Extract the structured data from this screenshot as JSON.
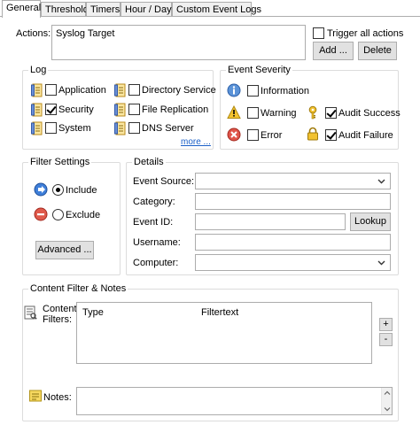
{
  "tabs": [
    {
      "label": "General",
      "active": true
    },
    {
      "label": "Threshold",
      "active": false
    },
    {
      "label": "Timers",
      "active": false
    },
    {
      "label": "Hour / Day",
      "active": false
    },
    {
      "label": "Custom Event Logs",
      "active": false
    }
  ],
  "actions": {
    "label": "Actions:",
    "items": [
      "Syslog Target"
    ],
    "trigger_all_label": "Trigger all actions",
    "trigger_all_checked": false,
    "add_label": "Add ...",
    "delete_label": "Delete"
  },
  "log": {
    "title": "Log",
    "items": [
      {
        "label": "Application",
        "checked": false
      },
      {
        "label": "Directory Service",
        "checked": false
      },
      {
        "label": "Security",
        "checked": true
      },
      {
        "label": "File Replication",
        "checked": false
      },
      {
        "label": "System",
        "checked": false
      },
      {
        "label": "DNS Server",
        "checked": false
      }
    ],
    "more_label": "more ..."
  },
  "event_severity": {
    "title": "Event Severity",
    "items": [
      {
        "label": "Information",
        "checked": false,
        "icon": "info-icon"
      },
      {
        "label": "Warning",
        "checked": false,
        "icon": "warning-icon"
      },
      {
        "label": "Audit Success",
        "checked": true,
        "icon": "key-icon"
      },
      {
        "label": "Error",
        "checked": false,
        "icon": "error-icon"
      },
      {
        "label": "Audit Failure",
        "checked": true,
        "icon": "lock-icon"
      }
    ]
  },
  "filter_settings": {
    "title": "Filter Settings",
    "include_label": "Include",
    "exclude_label": "Exclude",
    "selected": "include",
    "advanced_label": "Advanced ..."
  },
  "details": {
    "title": "Details",
    "event_source_label": "Event Source:",
    "category_label": "Category:",
    "event_id_label": "Event ID:",
    "lookup_label": "Lookup",
    "username_label": "Username:",
    "computer_label": "Computer:",
    "event_source_value": "",
    "category_value": "",
    "event_id_value": "",
    "username_value": "",
    "computer_value": ""
  },
  "content_filter": {
    "title": "Content Filter & Notes",
    "filters_label_1": "Content",
    "filters_label_2": "Filters:",
    "col_type": "Type",
    "col_filtertext": "Filtertext",
    "plus_label": "+",
    "minus_label": "-",
    "notes_label": "Notes:",
    "notes_value": ""
  },
  "colors": {
    "tab_border": "#adadad",
    "group_border": "#dcdcdc",
    "button_bg": "#e1e1e1",
    "link": "#1a5fc7",
    "info_blue": "#3a78c8",
    "error_red": "#d9463b",
    "warning_yellow": "#f4c430",
    "include_blue": "#2f6fd1",
    "exclude_red": "#d94a3b"
  }
}
